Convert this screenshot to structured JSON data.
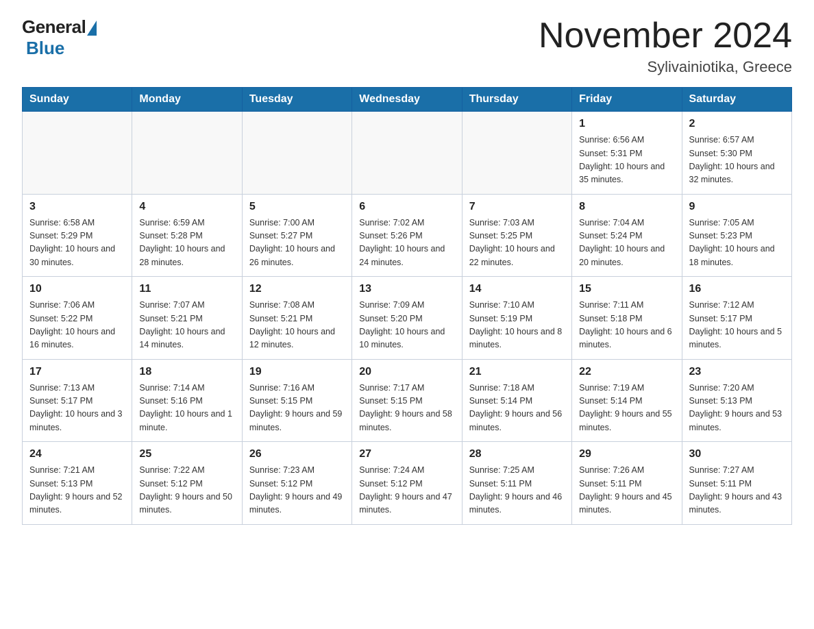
{
  "header": {
    "logo_general": "General",
    "logo_blue": "Blue",
    "month_year": "November 2024",
    "location": "Sylivainiotika, Greece"
  },
  "days_of_week": [
    "Sunday",
    "Monday",
    "Tuesday",
    "Wednesday",
    "Thursday",
    "Friday",
    "Saturday"
  ],
  "weeks": [
    [
      {
        "day": "",
        "info": ""
      },
      {
        "day": "",
        "info": ""
      },
      {
        "day": "",
        "info": ""
      },
      {
        "day": "",
        "info": ""
      },
      {
        "day": "",
        "info": ""
      },
      {
        "day": "1",
        "info": "Sunrise: 6:56 AM\nSunset: 5:31 PM\nDaylight: 10 hours and 35 minutes."
      },
      {
        "day": "2",
        "info": "Sunrise: 6:57 AM\nSunset: 5:30 PM\nDaylight: 10 hours and 32 minutes."
      }
    ],
    [
      {
        "day": "3",
        "info": "Sunrise: 6:58 AM\nSunset: 5:29 PM\nDaylight: 10 hours and 30 minutes."
      },
      {
        "day": "4",
        "info": "Sunrise: 6:59 AM\nSunset: 5:28 PM\nDaylight: 10 hours and 28 minutes."
      },
      {
        "day": "5",
        "info": "Sunrise: 7:00 AM\nSunset: 5:27 PM\nDaylight: 10 hours and 26 minutes."
      },
      {
        "day": "6",
        "info": "Sunrise: 7:02 AM\nSunset: 5:26 PM\nDaylight: 10 hours and 24 minutes."
      },
      {
        "day": "7",
        "info": "Sunrise: 7:03 AM\nSunset: 5:25 PM\nDaylight: 10 hours and 22 minutes."
      },
      {
        "day": "8",
        "info": "Sunrise: 7:04 AM\nSunset: 5:24 PM\nDaylight: 10 hours and 20 minutes."
      },
      {
        "day": "9",
        "info": "Sunrise: 7:05 AM\nSunset: 5:23 PM\nDaylight: 10 hours and 18 minutes."
      }
    ],
    [
      {
        "day": "10",
        "info": "Sunrise: 7:06 AM\nSunset: 5:22 PM\nDaylight: 10 hours and 16 minutes."
      },
      {
        "day": "11",
        "info": "Sunrise: 7:07 AM\nSunset: 5:21 PM\nDaylight: 10 hours and 14 minutes."
      },
      {
        "day": "12",
        "info": "Sunrise: 7:08 AM\nSunset: 5:21 PM\nDaylight: 10 hours and 12 minutes."
      },
      {
        "day": "13",
        "info": "Sunrise: 7:09 AM\nSunset: 5:20 PM\nDaylight: 10 hours and 10 minutes."
      },
      {
        "day": "14",
        "info": "Sunrise: 7:10 AM\nSunset: 5:19 PM\nDaylight: 10 hours and 8 minutes."
      },
      {
        "day": "15",
        "info": "Sunrise: 7:11 AM\nSunset: 5:18 PM\nDaylight: 10 hours and 6 minutes."
      },
      {
        "day": "16",
        "info": "Sunrise: 7:12 AM\nSunset: 5:17 PM\nDaylight: 10 hours and 5 minutes."
      }
    ],
    [
      {
        "day": "17",
        "info": "Sunrise: 7:13 AM\nSunset: 5:17 PM\nDaylight: 10 hours and 3 minutes."
      },
      {
        "day": "18",
        "info": "Sunrise: 7:14 AM\nSunset: 5:16 PM\nDaylight: 10 hours and 1 minute."
      },
      {
        "day": "19",
        "info": "Sunrise: 7:16 AM\nSunset: 5:15 PM\nDaylight: 9 hours and 59 minutes."
      },
      {
        "day": "20",
        "info": "Sunrise: 7:17 AM\nSunset: 5:15 PM\nDaylight: 9 hours and 58 minutes."
      },
      {
        "day": "21",
        "info": "Sunrise: 7:18 AM\nSunset: 5:14 PM\nDaylight: 9 hours and 56 minutes."
      },
      {
        "day": "22",
        "info": "Sunrise: 7:19 AM\nSunset: 5:14 PM\nDaylight: 9 hours and 55 minutes."
      },
      {
        "day": "23",
        "info": "Sunrise: 7:20 AM\nSunset: 5:13 PM\nDaylight: 9 hours and 53 minutes."
      }
    ],
    [
      {
        "day": "24",
        "info": "Sunrise: 7:21 AM\nSunset: 5:13 PM\nDaylight: 9 hours and 52 minutes."
      },
      {
        "day": "25",
        "info": "Sunrise: 7:22 AM\nSunset: 5:12 PM\nDaylight: 9 hours and 50 minutes."
      },
      {
        "day": "26",
        "info": "Sunrise: 7:23 AM\nSunset: 5:12 PM\nDaylight: 9 hours and 49 minutes."
      },
      {
        "day": "27",
        "info": "Sunrise: 7:24 AM\nSunset: 5:12 PM\nDaylight: 9 hours and 47 minutes."
      },
      {
        "day": "28",
        "info": "Sunrise: 7:25 AM\nSunset: 5:11 PM\nDaylight: 9 hours and 46 minutes."
      },
      {
        "day": "29",
        "info": "Sunrise: 7:26 AM\nSunset: 5:11 PM\nDaylight: 9 hours and 45 minutes."
      },
      {
        "day": "30",
        "info": "Sunrise: 7:27 AM\nSunset: 5:11 PM\nDaylight: 9 hours and 43 minutes."
      }
    ]
  ]
}
